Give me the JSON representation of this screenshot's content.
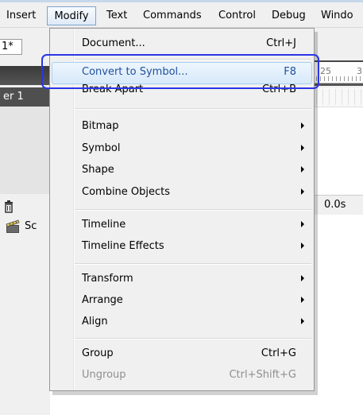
{
  "menubar": {
    "items": [
      {
        "label": "Insert"
      },
      {
        "label": "Modify"
      },
      {
        "label": "Text"
      },
      {
        "label": "Commands"
      },
      {
        "label": "Control"
      },
      {
        "label": "Debug"
      },
      {
        "label": "Windo"
      }
    ]
  },
  "workspace": {
    "doc_tab": "1*",
    "layer": "er 1",
    "scene": "Sc",
    "time": "0.0s",
    "ruler": [
      "25",
      "3"
    ]
  },
  "menu": {
    "items": [
      {
        "label": "Document...",
        "shortcut": "Ctrl+J"
      },
      {
        "label": "Convert to Symbol...",
        "shortcut": "F8"
      },
      {
        "label": "Break Apart",
        "shortcut": "Ctrl+B"
      },
      {
        "label": "Bitmap"
      },
      {
        "label": "Symbol"
      },
      {
        "label": "Shape"
      },
      {
        "label": "Combine Objects"
      },
      {
        "label": "Timeline"
      },
      {
        "label": "Timeline Effects"
      },
      {
        "label": "Transform"
      },
      {
        "label": "Arrange"
      },
      {
        "label": "Align"
      },
      {
        "label": "Group",
        "shortcut": "Ctrl+G"
      },
      {
        "label": "Ungroup",
        "shortcut": "Ctrl+Shift+G"
      }
    ]
  }
}
